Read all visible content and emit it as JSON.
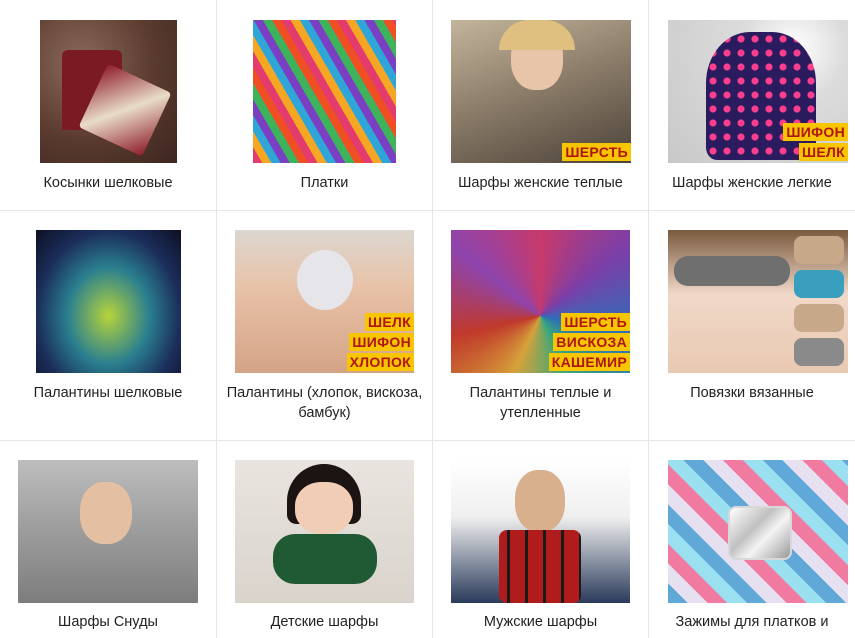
{
  "catalog": {
    "categories": [
      {
        "label": "Косынки шелковые",
        "image_alt": "Шелковая косынка с сумкой",
        "badges": []
      },
      {
        "label": "Платки",
        "image_alt": "Разноцветные платки",
        "badges": []
      },
      {
        "label": "Шарфы женские теплые",
        "image_alt": "Женщина в теплом шарфе",
        "badges": [
          "ШЕРСТЬ"
        ]
      },
      {
        "label": "Шарфы женские легкие",
        "image_alt": "Легкий шарф в горошек",
        "badges": [
          "ШИФОН",
          "ШЕЛК"
        ]
      },
      {
        "label": "Палантины шелковые",
        "image_alt": "Шелковый палантин",
        "badges": []
      },
      {
        "label": "Палантины (хлопок, вискоза, бамбук)",
        "image_alt": "Палантин из хлопка",
        "badges": [
          "ШЕЛК",
          "ШИФОН",
          "ХЛОПОК"
        ]
      },
      {
        "label": "Палантины теплые и утепленные",
        "image_alt": "Теплые палантины",
        "badges": [
          "ШЕРСТЬ",
          "ВИСКОЗА",
          "КАШЕМИР"
        ]
      },
      {
        "label": "Повязки вязанные",
        "image_alt": "Вязаные повязки",
        "badges": []
      },
      {
        "label": "Шарфы Снуды",
        "image_alt": "Женщина в шарфе-снуде",
        "badges": []
      },
      {
        "label": "Детские шарфы",
        "image_alt": "Девочка в детском шарфе",
        "badges": []
      },
      {
        "label": "Мужские шарфы",
        "image_alt": "Мужчина в клетчатом шарфе",
        "badges": []
      },
      {
        "label": "Зажимы для платков и",
        "image_alt": "Зажим для платка",
        "badges": []
      }
    ]
  },
  "colors": {
    "badge_bg": "#f7c600",
    "badge_text": "#b01515",
    "grid_line": "#e6e6e6"
  }
}
